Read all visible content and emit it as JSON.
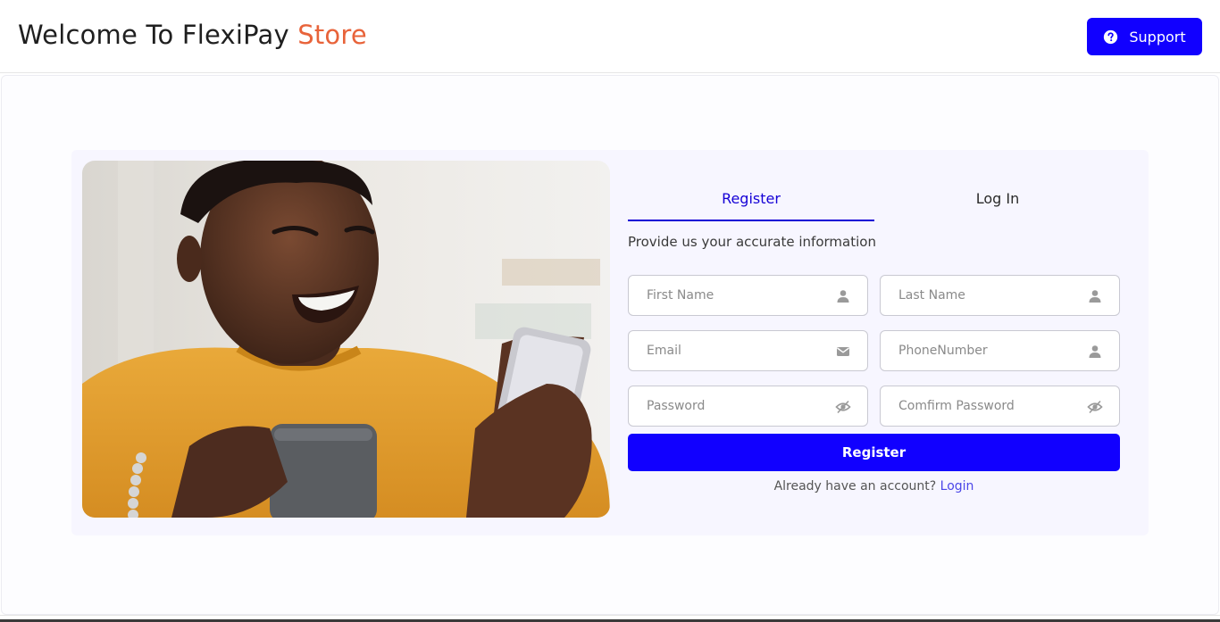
{
  "header": {
    "title_main": "Welcome To FlexiPay",
    "title_accent": "Store",
    "support_label": "Support"
  },
  "colors": {
    "brand_blue": "#1100ff",
    "accent_orange": "#e8633a",
    "card_bg": "#f7f6ff"
  },
  "tabs": [
    {
      "label": "Register",
      "active": true
    },
    {
      "label": "Log In",
      "active": false
    }
  ],
  "form": {
    "subtitle": "Provide us your accurate information",
    "fields": [
      {
        "placeholder": "First Name",
        "icon": "user-icon",
        "value": ""
      },
      {
        "placeholder": "Last Name",
        "icon": "user-icon",
        "value": ""
      },
      {
        "placeholder": "Email",
        "icon": "mail-icon",
        "value": ""
      },
      {
        "placeholder": "PhoneNumber",
        "icon": "user-icon",
        "value": ""
      },
      {
        "placeholder": "Password",
        "icon": "eye-off-icon",
        "value": ""
      },
      {
        "placeholder": "Comfirm Password",
        "icon": "eye-off-icon",
        "value": ""
      }
    ],
    "submit_label": "Register",
    "account_prompt": "Already have an account?",
    "login_link": "Login"
  }
}
